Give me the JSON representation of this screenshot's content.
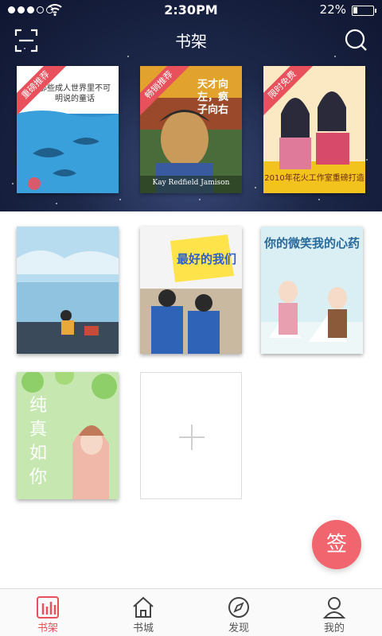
{
  "status_bar": {
    "time": "2:30PM",
    "battery": "22%",
    "battery_level": 0.22
  },
  "header": {
    "title": "书架"
  },
  "books": [
    {
      "cover_title": "那些成人世界里不可明说的童话",
      "badge": "重磅推荐",
      "palette": "blue-ocean"
    },
    {
      "cover_title": "天才向左，疯子向右",
      "cover_subtitle": "Kay Redfield Jamison",
      "badge": "畅销推荐",
      "palette": "van-gogh"
    },
    {
      "cover_title": "2010年花火工作室重磅打造",
      "badge": "限时免费",
      "palette": "yellow-ancient"
    },
    {
      "cover_title": "",
      "palette": "sky-sea"
    },
    {
      "cover_title": "最好的我们",
      "palette": "school"
    },
    {
      "cover_title": "你的微笑我的心药",
      "palette": "violin"
    },
    {
      "cover_title": "纯真如你",
      "palette": "green-girl"
    }
  ],
  "add_book": {
    "icon": "plus-icon"
  },
  "sign_button": {
    "label": "签"
  },
  "tabbar": {
    "items": [
      {
        "label": "书架",
        "icon": "bookshelf-icon",
        "active": true
      },
      {
        "label": "书城",
        "icon": "house-icon",
        "active": false
      },
      {
        "label": "发现",
        "icon": "compass-icon",
        "active": false
      },
      {
        "label": "我的",
        "icon": "person-icon",
        "active": false
      }
    ]
  },
  "colors": {
    "accent": "#e8505b",
    "header_bg": "#1c2748"
  }
}
